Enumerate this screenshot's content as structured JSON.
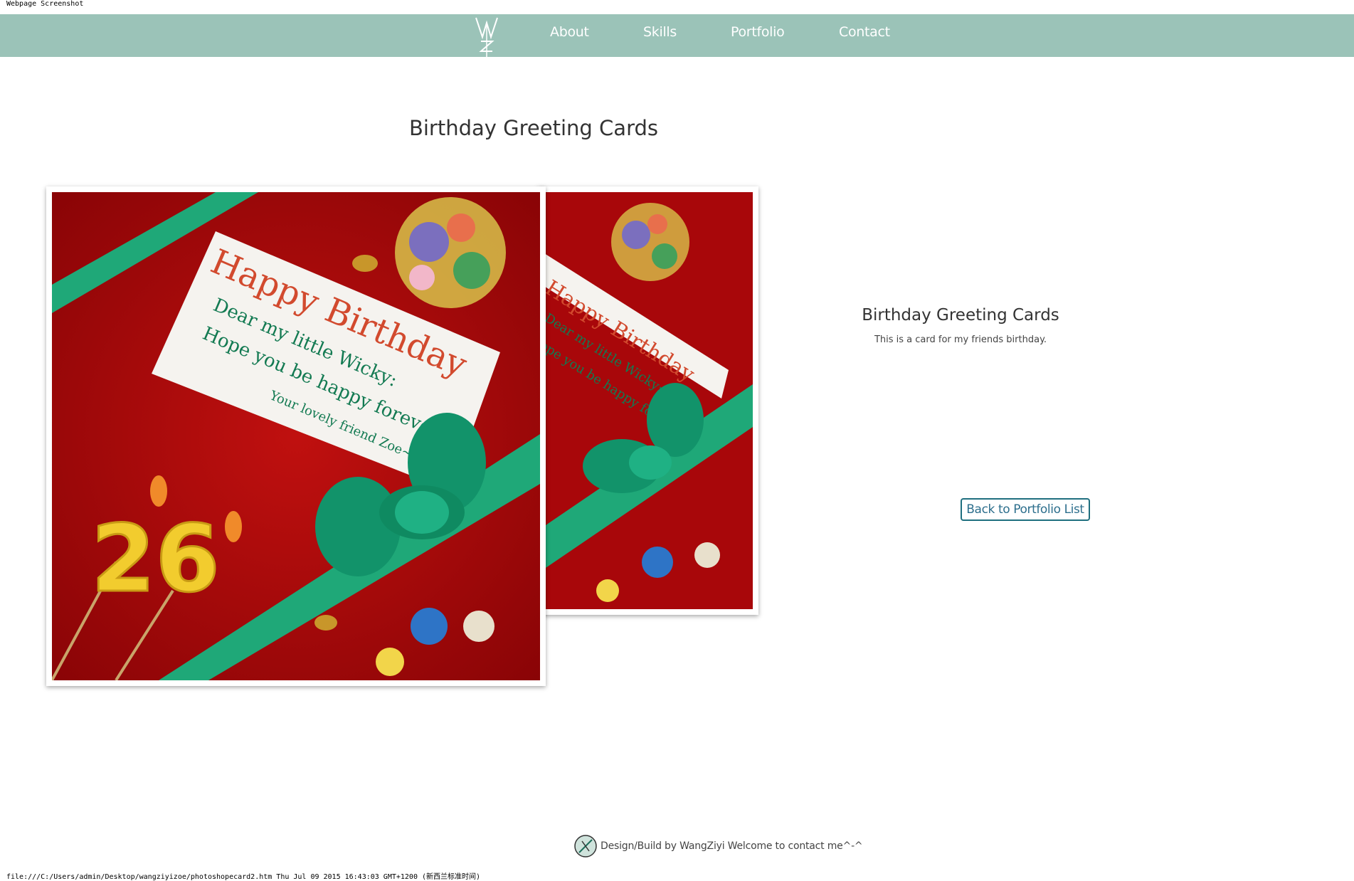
{
  "print_header": "Webpage Screenshot",
  "nav": {
    "logo_alt": "WZ",
    "items": [
      {
        "label": "About"
      },
      {
        "label": "Skills"
      },
      {
        "label": "Portfolio"
      },
      {
        "label": "Contact"
      }
    ]
  },
  "main": {
    "title": "Birthday Greeting Cards",
    "card_text": {
      "headline": "Happy Birthday",
      "line1": "Dear my little Wicky:",
      "line2": "Hope you be happy forever.",
      "signature": "Your lovely friend Zoe~~",
      "number": "26"
    }
  },
  "side": {
    "title": "Birthday Greeting Cards",
    "description": "This is a card for my friends birthday.",
    "back_button": "Back to Portfolio List"
  },
  "footer": {
    "text": "Design/Build by WangZiyi Welcome to contact me^-^"
  },
  "print_footer": "file:///C:/Users/admin/Desktop/wangziyizoe/photoshopecard2.htm Thu Jul 09 2015 16:43:03 GMT+1200 (新西兰标准时间)",
  "colors": {
    "nav_bg": "#9bc3b8",
    "card_red": "#a8070a",
    "ribbon_green": "#1fa878",
    "button_border": "#1f6f7f"
  }
}
